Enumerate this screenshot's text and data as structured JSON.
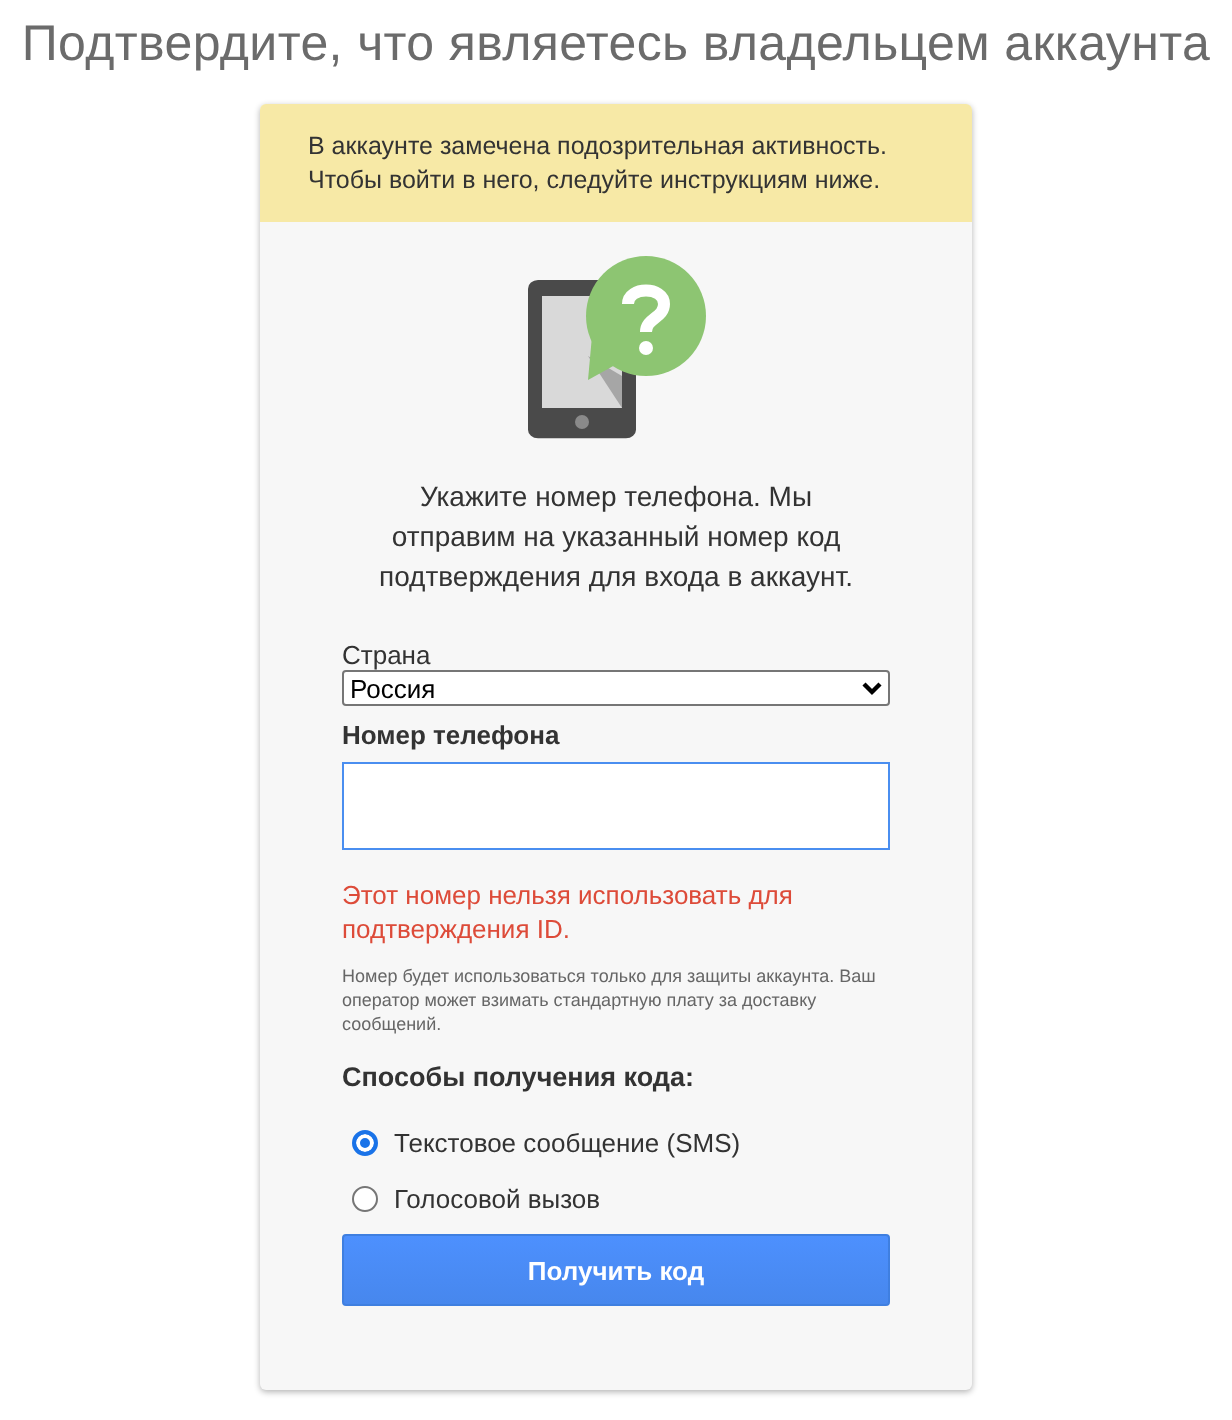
{
  "page_title": "Подтвердите, что являетесь владельцем аккаунта",
  "warning": "В аккаунте замечена подозрительная активность. Чтобы войти в него, следуйте инструкциям ниже.",
  "instructions": "Укажите номер телефона. Мы отправим на указанный номер код подтверждения для входа в аккаунт.",
  "country": {
    "label": "Страна",
    "value": "Россия"
  },
  "phone": {
    "label": "Номер телефона",
    "focused": true
  },
  "error": "Этот номер нельзя использовать для подтверждения ID.",
  "note": "Номер будет использоваться только для защиты аккаунта. Ваш оператор может взимать стандартную плату за доставку сообщений.",
  "methods_title": "Способы получения кода:",
  "methods": [
    {
      "label": "Текстовое сообщение (SMS)",
      "selected": true
    },
    {
      "label": "Голосовой вызов",
      "selected": false
    }
  ],
  "submit": "Получить код"
}
